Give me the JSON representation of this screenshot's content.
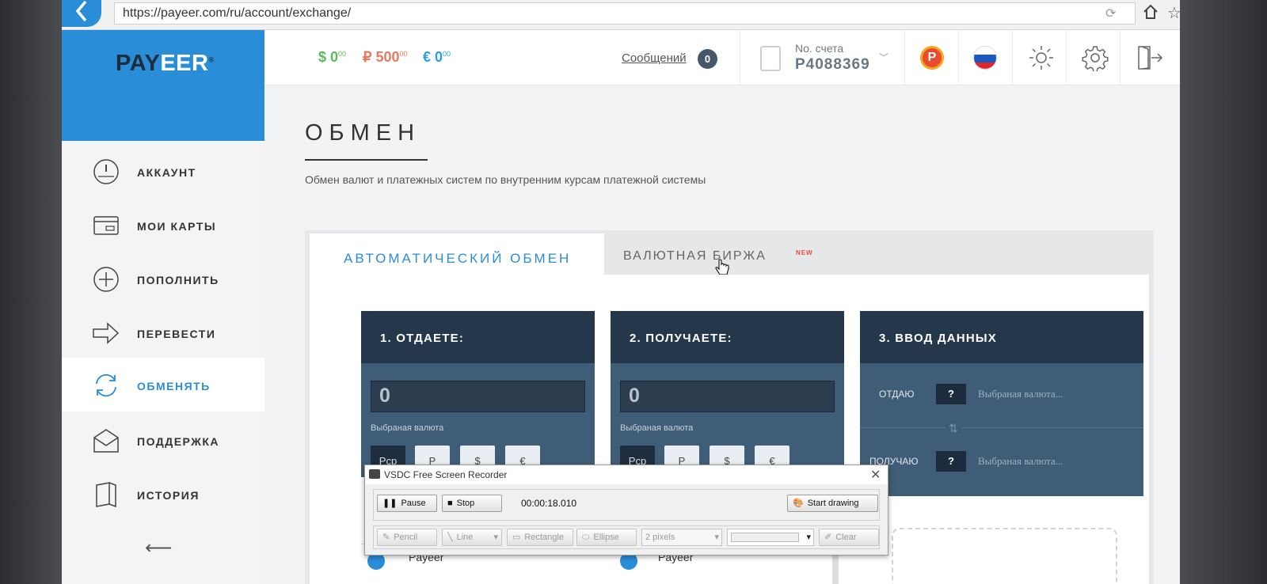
{
  "browser": {
    "url": "https://payeer.com/ru/account/exchange/"
  },
  "brand": {
    "logo_pay": "PAY",
    "logo_eer": "EER",
    "logo_reg": "®",
    "accent": "#2a8dd8",
    "dark": "#25384b"
  },
  "header": {
    "balances": [
      {
        "currency": "USD",
        "symbol": "$",
        "amount": "0",
        "cents": "00",
        "color": "#5cb85c"
      },
      {
        "currency": "RUB",
        "symbol": "₽",
        "amount": "500",
        "cents": "00",
        "color": "#e8795f"
      },
      {
        "currency": "EUR",
        "symbol": "€",
        "amount": "0",
        "cents": "00",
        "color": "#2a9fd8"
      }
    ],
    "messages_label": "Сообщений",
    "messages_count": "0",
    "account_label": "No. счета",
    "account_number": "P4088369",
    "icons": [
      "payeer-coin-icon",
      "russia-flag-icon",
      "brightness-icon",
      "gear-icon",
      "logout-icon"
    ]
  },
  "sidebar": {
    "items": [
      {
        "label": "АККАУНТ",
        "icon": "dashboard-icon",
        "active": false
      },
      {
        "label": "МОИ КАРТЫ",
        "icon": "card-icon",
        "active": false
      },
      {
        "label": "ПОПОЛНИТЬ",
        "icon": "plus-circle-icon",
        "active": false
      },
      {
        "label": "ПЕРЕВЕСТИ",
        "icon": "arrow-right-icon",
        "active": false
      },
      {
        "label": "ОБМЕНЯТЬ",
        "icon": "exchange-icon",
        "active": true
      },
      {
        "label": "ПОДДЕРЖКА",
        "icon": "envelope-icon",
        "active": false
      },
      {
        "label": "ИСТОРИЯ",
        "icon": "book-icon",
        "active": false
      }
    ],
    "collapse_symbol": "⟵"
  },
  "main": {
    "title": "ОБМЕН",
    "description": "Обмен валют и платежных систем по внутренним курсам платежной системы",
    "tabs": [
      {
        "label": "АВТОМАТИЧЕСКИЙ ОБМЕН",
        "active": true
      },
      {
        "label": "ВАЛЮТНАЯ БИРЖА",
        "active": false,
        "badge": "NEW"
      }
    ],
    "give": {
      "header": "1. ОТДАЕТЕ:",
      "amount": "0",
      "selected_label": "Выбраная валюта",
      "currency_buttons": [
        "Pcp",
        "Р",
        "$",
        "€"
      ]
    },
    "receive": {
      "header": "2. ПОЛУЧАЕТЕ:",
      "amount": "0",
      "selected_label": "Выбраная валюта",
      "currency_buttons": [
        "Pcp",
        "Р",
        "$",
        "€"
      ]
    },
    "data_entry": {
      "header": "3. ВВОД ДАННЫХ",
      "give_label": "ОТДАЮ",
      "receive_label": "ПОЛУЧАЮ",
      "placeholder_symbol": "?",
      "selected_text": "Выбраная валюта...",
      "swap_symbol": "⇅"
    },
    "partial_list_item": "Payeer"
  },
  "recorder": {
    "title": "VSDC Free Screen Recorder",
    "pause_label": "Pause",
    "stop_label": "Stop",
    "timer": "00:00:18.010",
    "start_drawing_label": "Start drawing",
    "pencil_label": "Pencil",
    "line_label": "Line",
    "rectangle_label": "Rectangle",
    "ellipse_label": "Ellipse",
    "size_value": "2 pixels",
    "clear_label": "Clear"
  }
}
